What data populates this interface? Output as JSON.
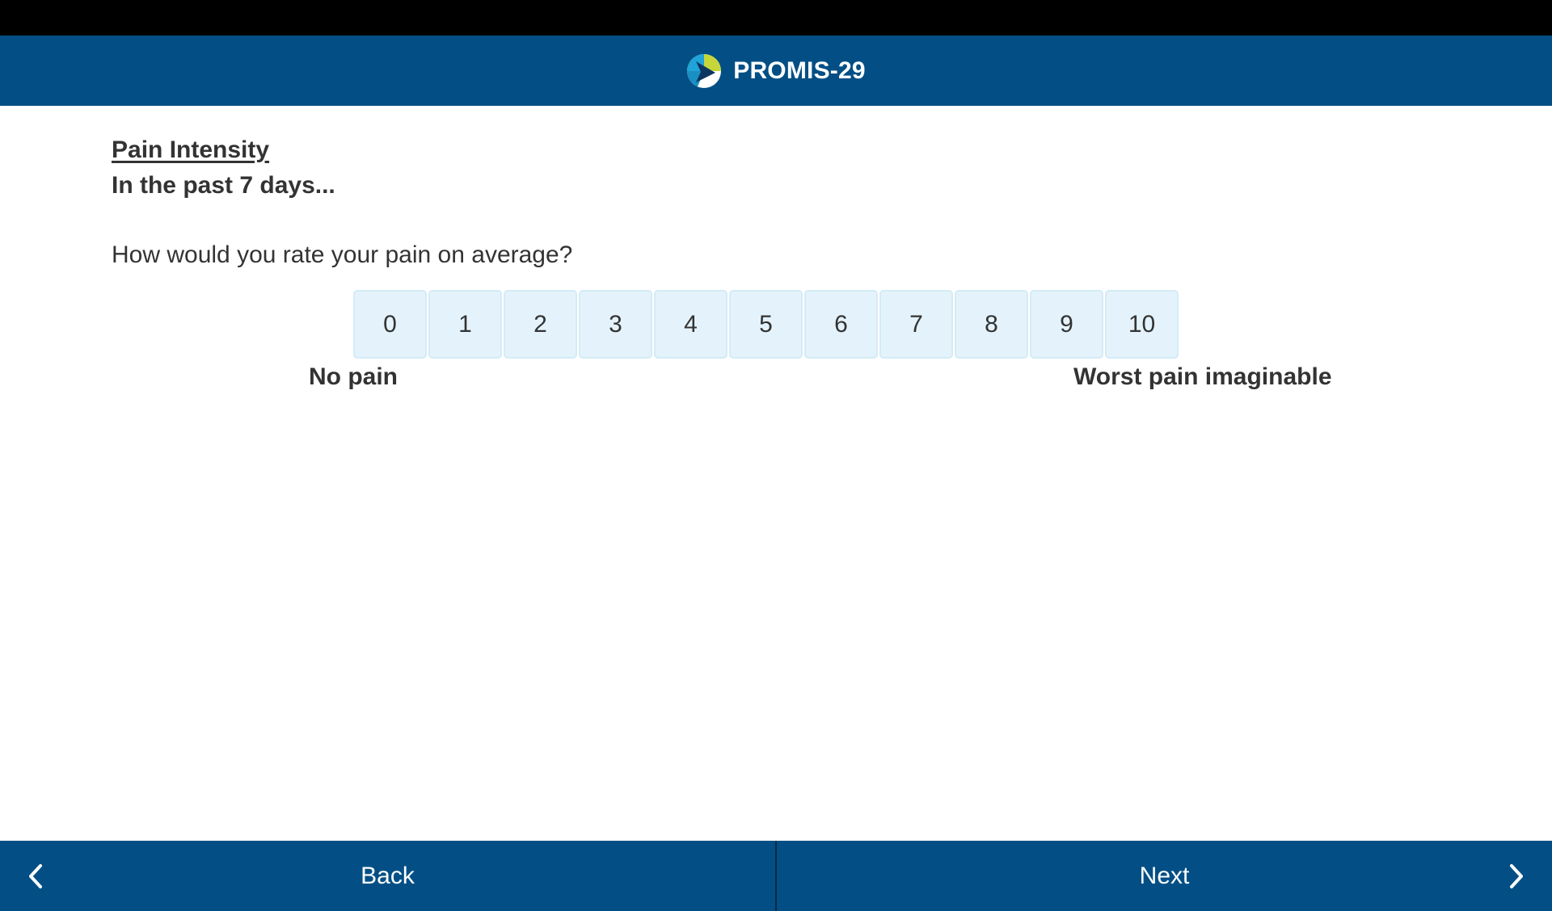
{
  "app": {
    "title": "PROMIS-29",
    "logo_icon": "promis-logo-icon"
  },
  "colors": {
    "brand": "#034f85",
    "option_bg": "#e4f3fb",
    "option_border": "#d4ebf6",
    "logo_green": "#c6d63a",
    "logo_blue": "#1fa3d8",
    "logo_navy": "#0c3560"
  },
  "question": {
    "section": "Pain Intensity",
    "timeframe": "In the past 7 days...",
    "text": "How would you rate your pain on average?",
    "options": [
      "0",
      "1",
      "2",
      "3",
      "4",
      "5",
      "6",
      "7",
      "8",
      "9",
      "10"
    ],
    "anchor_low": "No pain",
    "anchor_high": "Worst pain imaginable",
    "selected": null
  },
  "footer": {
    "back_label": "Back",
    "next_label": "Next",
    "back_icon": "chevron-left-icon",
    "next_icon": "chevron-right-icon"
  }
}
